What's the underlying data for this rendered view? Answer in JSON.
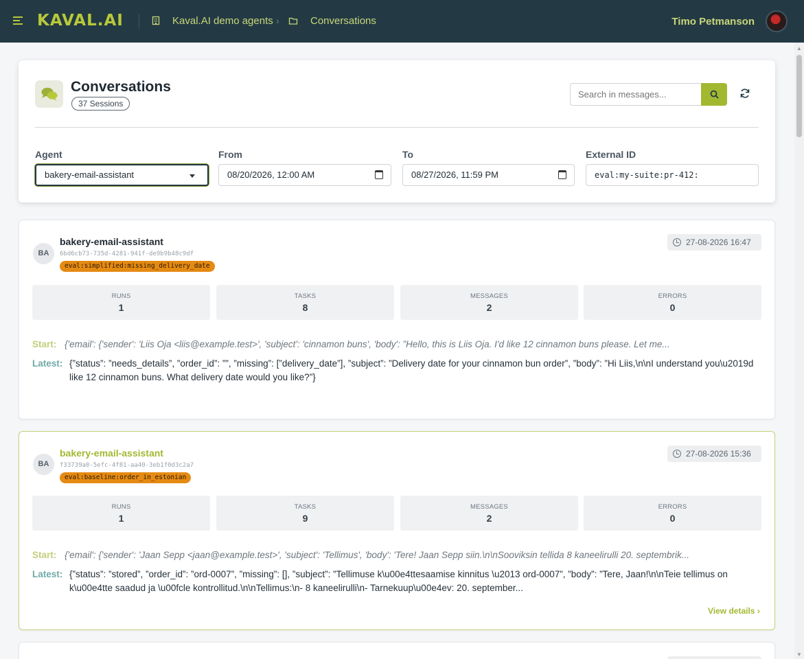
{
  "brand": {
    "logo": "KAVAL.AI",
    "accent": "#b7c93a",
    "nav_bg": "#233a44"
  },
  "breadcrumb": {
    "org": "Kaval.AI demo agents",
    "page": "Conversations"
  },
  "user": {
    "name": "Timo Petmanson"
  },
  "header": {
    "title": "Conversations",
    "sessions_badge": "37 Sessions",
    "search_placeholder": "Search in messages..."
  },
  "filters": {
    "agent_label": "Agent",
    "agent_value": "bakery-email-assistant",
    "from_label": "From",
    "from_value": "08/20/2026, 12:00 AM",
    "to_label": "To",
    "to_value": "08/27/2026, 11:59 PM",
    "external_id_label": "External ID",
    "external_id_value": "eval:my-suite:pr-412:"
  },
  "stat_labels": {
    "runs": "RUNS",
    "tasks": "TASKS",
    "messages": "MESSAGES",
    "errors": "ERRORS"
  },
  "line_labels": {
    "start": "Start:",
    "latest": "Latest:"
  },
  "sessions": [
    {
      "initials": "BA",
      "agent": "bakery-email-assistant",
      "id": "6bd6cb73-735d-4281-941f-de9b9b48c9df",
      "tag": "eval:simplified:missing_delivery_date",
      "time": "27-08-2026 16:47",
      "runs": "1",
      "tasks": "8",
      "messages": "2",
      "errors": "0",
      "start": "{'email': {'sender': 'Liis Oja <liis@example.test>', 'subject': 'cinnamon buns', 'body': ”Hello, this is Liis Oja. I'd like 12 cinnamon buns please. Let me...",
      "latest": "{”status”: ”needs_details”, ”order_id”: ””, ”missing”: [”delivery_date”], ”subject”: ”Delivery date for your cinnamon bun order”, ”body”: ”Hi Liis,\\n\\nI understand you\\u2019d like 12 cinnamon buns. What delivery date would you like?”}"
    },
    {
      "initials": "BA",
      "agent": "bakery-email-assistant",
      "id": "f33739a0-5efc-4f81-aa40-3eb1f0d3c2a7",
      "tag": "eval:baseline:order_in_estonian",
      "time": "27-08-2026 15:36",
      "runs": "1",
      "tasks": "9",
      "messages": "2",
      "errors": "0",
      "start": "{'email': {'sender': 'Jaan Sepp <jaan@example.test>', 'subject': 'Tellimus', 'body': 'Tere! Jaan Sepp siin.\\n\\nSooviksin tellida 8 kaneelirulli 20. septembrik...",
      "latest": "{”status”: ”stored”, ”order_id”: ”ord-0007”, ”missing”: [], ”subject”: ”Tellimuse k\\u00e4ttesaamise kinnitus \\u2013 ord-0007”, ”body”: ”Tere, Jaan!\\n\\nTeie tellimus on k\\u00e4tte saadud ja \\u00fcle kontrollitud.\\n\\nTellimus:\\n- 8 kaneelirulli\\n- Tarnekuup\\u00e4ev: 20. september...",
      "view_details": "View details"
    }
  ]
}
